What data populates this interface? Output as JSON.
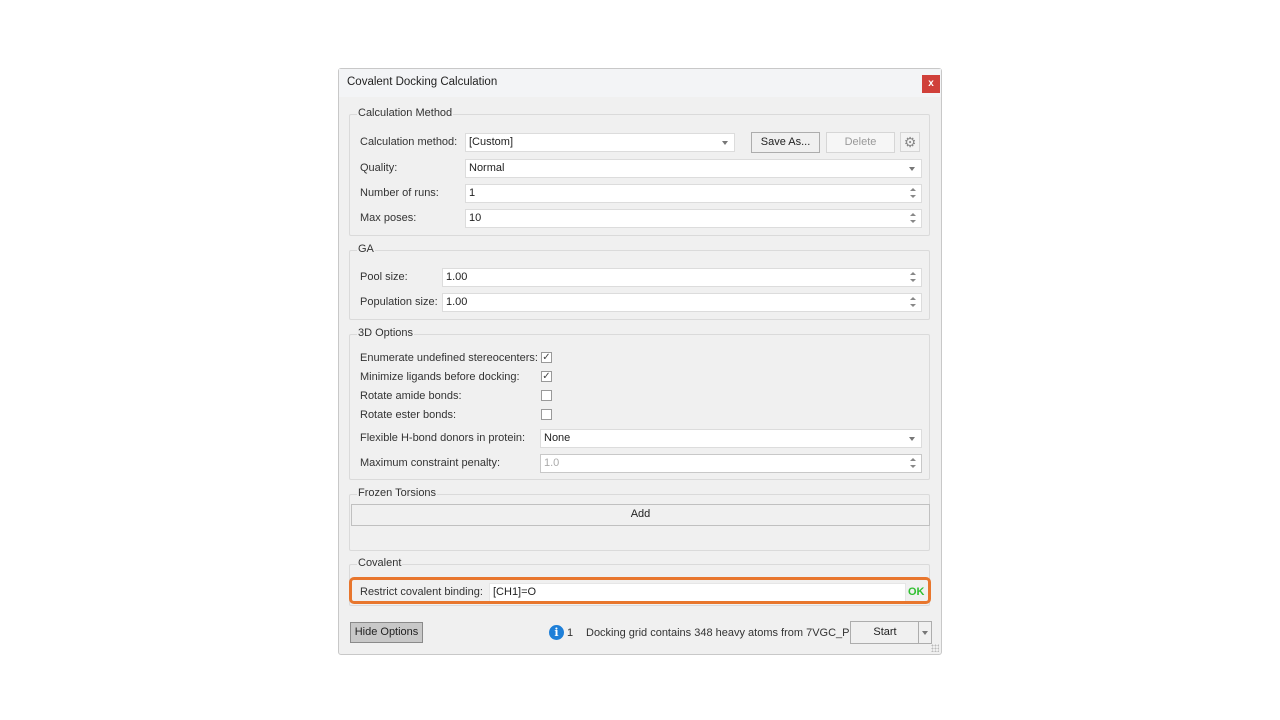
{
  "dialog": {
    "title": "Covalent Docking Calculation",
    "close_label": "x"
  },
  "calculation_method": {
    "group_label": "Calculation Method",
    "method_label": "Calculation method:",
    "method_value": "[Custom]",
    "save_as_label": "Save As...",
    "delete_label": "Delete",
    "settings_icon": "gear-icon",
    "quality_label": "Quality:",
    "quality_value": "Normal",
    "runs_label": "Number of runs:",
    "runs_value": "1",
    "max_poses_label": "Max poses:",
    "max_poses_value": "10"
  },
  "ga": {
    "group_label": "GA",
    "pool_size_label": "Pool size:",
    "pool_size_value": "1.00",
    "population_size_label": "Population size:",
    "population_size_value": "1.00"
  },
  "options_3d": {
    "group_label": "3D Options",
    "enumerate_label": "Enumerate undefined stereocenters:",
    "enumerate_checked": true,
    "minimize_label": "Minimize ligands before docking:",
    "minimize_checked": true,
    "rotate_amide_label": "Rotate amide bonds:",
    "rotate_amide_checked": false,
    "rotate_ester_label": "Rotate ester bonds:",
    "rotate_ester_checked": false,
    "flexible_label": "Flexible H-bond donors in protein:",
    "flexible_value": "None",
    "max_penalty_label": "Maximum constraint penalty:",
    "max_penalty_value": "1.0"
  },
  "frozen_torsions": {
    "group_label": "Frozen Torsions",
    "add_label": "Add"
  },
  "covalent": {
    "group_label": "Covalent",
    "restrict_label": "Restrict covalent binding:",
    "restrict_value": "[CH1]=O",
    "status": "OK",
    "highlight_color": "#e8762d"
  },
  "footer": {
    "hide_options_label": "Hide Options",
    "info_icon": "info-icon",
    "info_glyph": "i",
    "info_count": "1",
    "status_text": "Docking grid contains 348 heavy atoms from 7VGC_P",
    "start_label": "Start"
  }
}
